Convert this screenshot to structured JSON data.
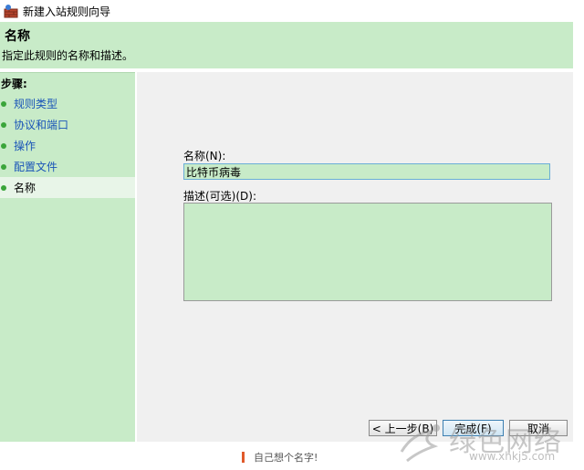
{
  "window": {
    "title": "新建入站规则向导"
  },
  "header": {
    "title": "名称",
    "description": "指定此规则的名称和描述。"
  },
  "sidebar": {
    "steps_label": "步骤:",
    "items": [
      {
        "label": "规则类型"
      },
      {
        "label": "协议和端口"
      },
      {
        "label": "操作"
      },
      {
        "label": "配置文件"
      },
      {
        "label": "名称"
      }
    ],
    "current_index": 4
  },
  "form": {
    "name_label": "名称(N):",
    "name_value": "比特币病毒",
    "description_label": "描述(可选)(D):",
    "description_value": ""
  },
  "buttons": {
    "back": "< 上一步(B)",
    "finish": "完成(F)",
    "cancel": "取消"
  },
  "caption": {
    "text": "自己想个名字!"
  },
  "watermark": {
    "text": "绿色网络",
    "url": "www.xhkj5.com"
  },
  "colors": {
    "accent_green": "#c8ebc8",
    "link_blue": "#1a55b8",
    "dot_green": "#3aa53a"
  }
}
